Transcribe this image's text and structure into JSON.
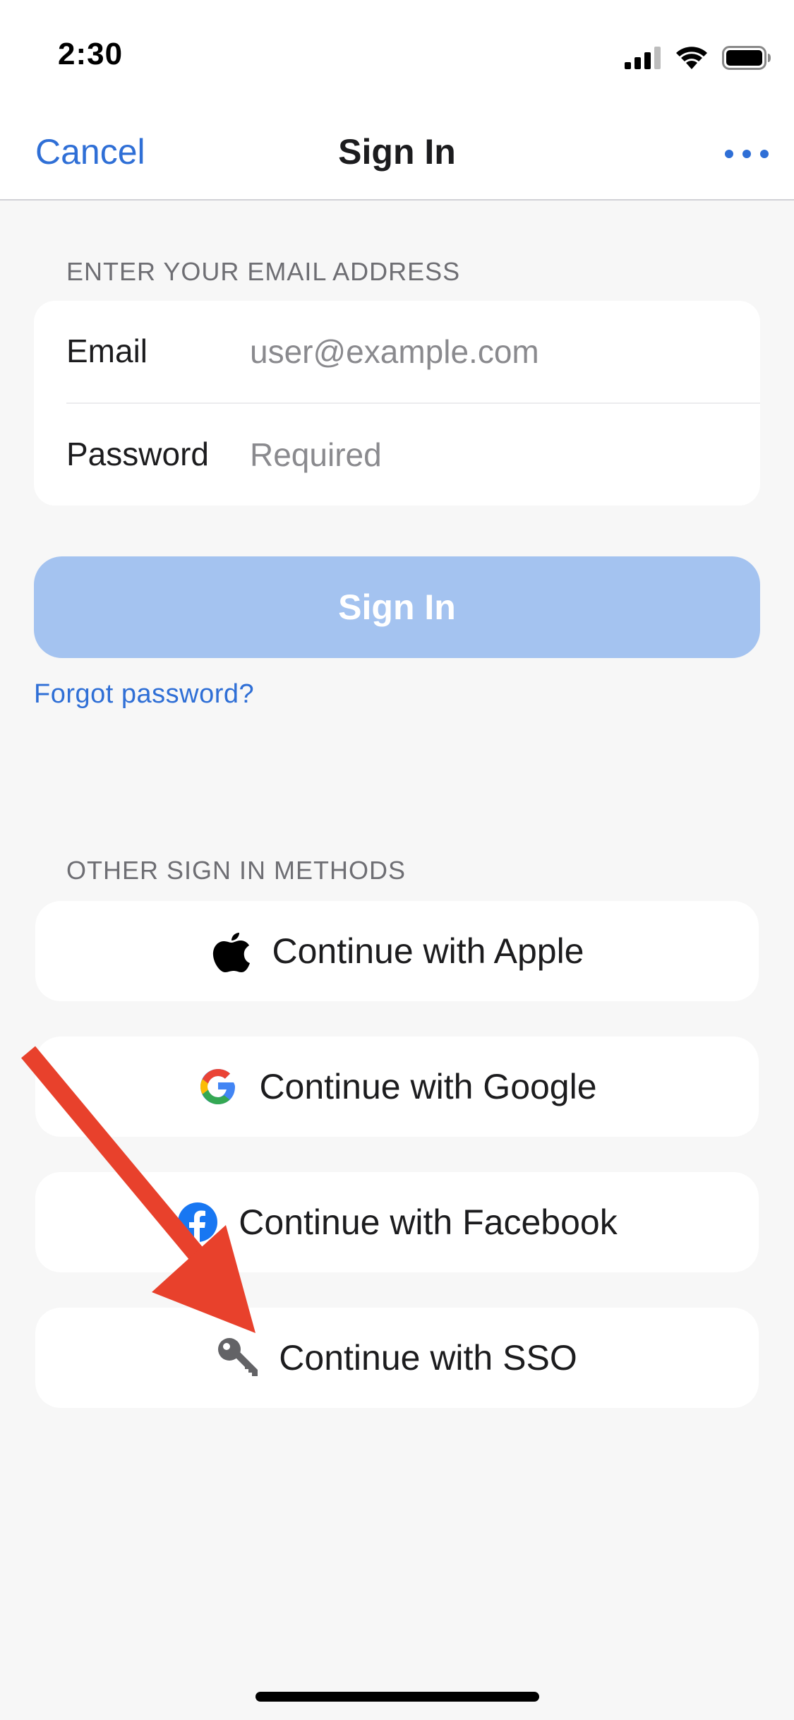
{
  "status_bar": {
    "time": "2:30",
    "icons": [
      "cellular-signal-icon",
      "wifi-icon",
      "battery-icon"
    ]
  },
  "nav": {
    "cancel_label": "Cancel",
    "title": "Sign In",
    "more_icon": "ellipsis-icon"
  },
  "email_section": {
    "header": "ENTER YOUR EMAIL ADDRESS",
    "email_label": "Email",
    "email_placeholder": "user@example.com",
    "email_value": "",
    "password_label": "Password",
    "password_placeholder": "Required",
    "password_value": ""
  },
  "signin_button": {
    "label": "Sign In",
    "state": "disabled"
  },
  "forgot_password": "Forgot password?",
  "other_methods": {
    "header": "OTHER SIGN IN METHODS",
    "buttons": [
      {
        "label": "Continue with Apple",
        "icon": "apple-icon"
      },
      {
        "label": "Continue with Google",
        "icon": "google-icon"
      },
      {
        "label": "Continue with Facebook",
        "icon": "facebook-icon"
      },
      {
        "label": "Continue with SSO",
        "icon": "key-icon"
      }
    ]
  },
  "colors": {
    "accent": "#2f6fd6",
    "disabled_button": "#a4c3f0",
    "background": "#f7f7f7",
    "annotation_arrow": "#e8412c"
  }
}
